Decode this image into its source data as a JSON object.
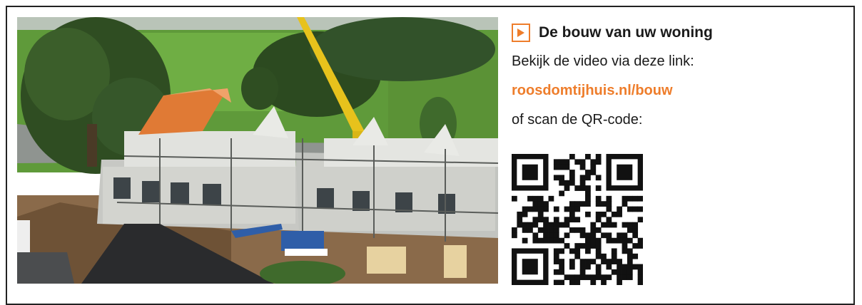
{
  "video": {
    "title": "De bouw van uw woning",
    "intro": "Bekijk de video via deze link:",
    "link": "roosdomtijhuis.nl/bouw",
    "qr_prompt": "of scan de QR-code:"
  },
  "colors": {
    "accent": "#ee7d2b",
    "text": "#1a1a1a",
    "border": "#222222"
  },
  "icons": {
    "title_icon": "play-icon"
  }
}
